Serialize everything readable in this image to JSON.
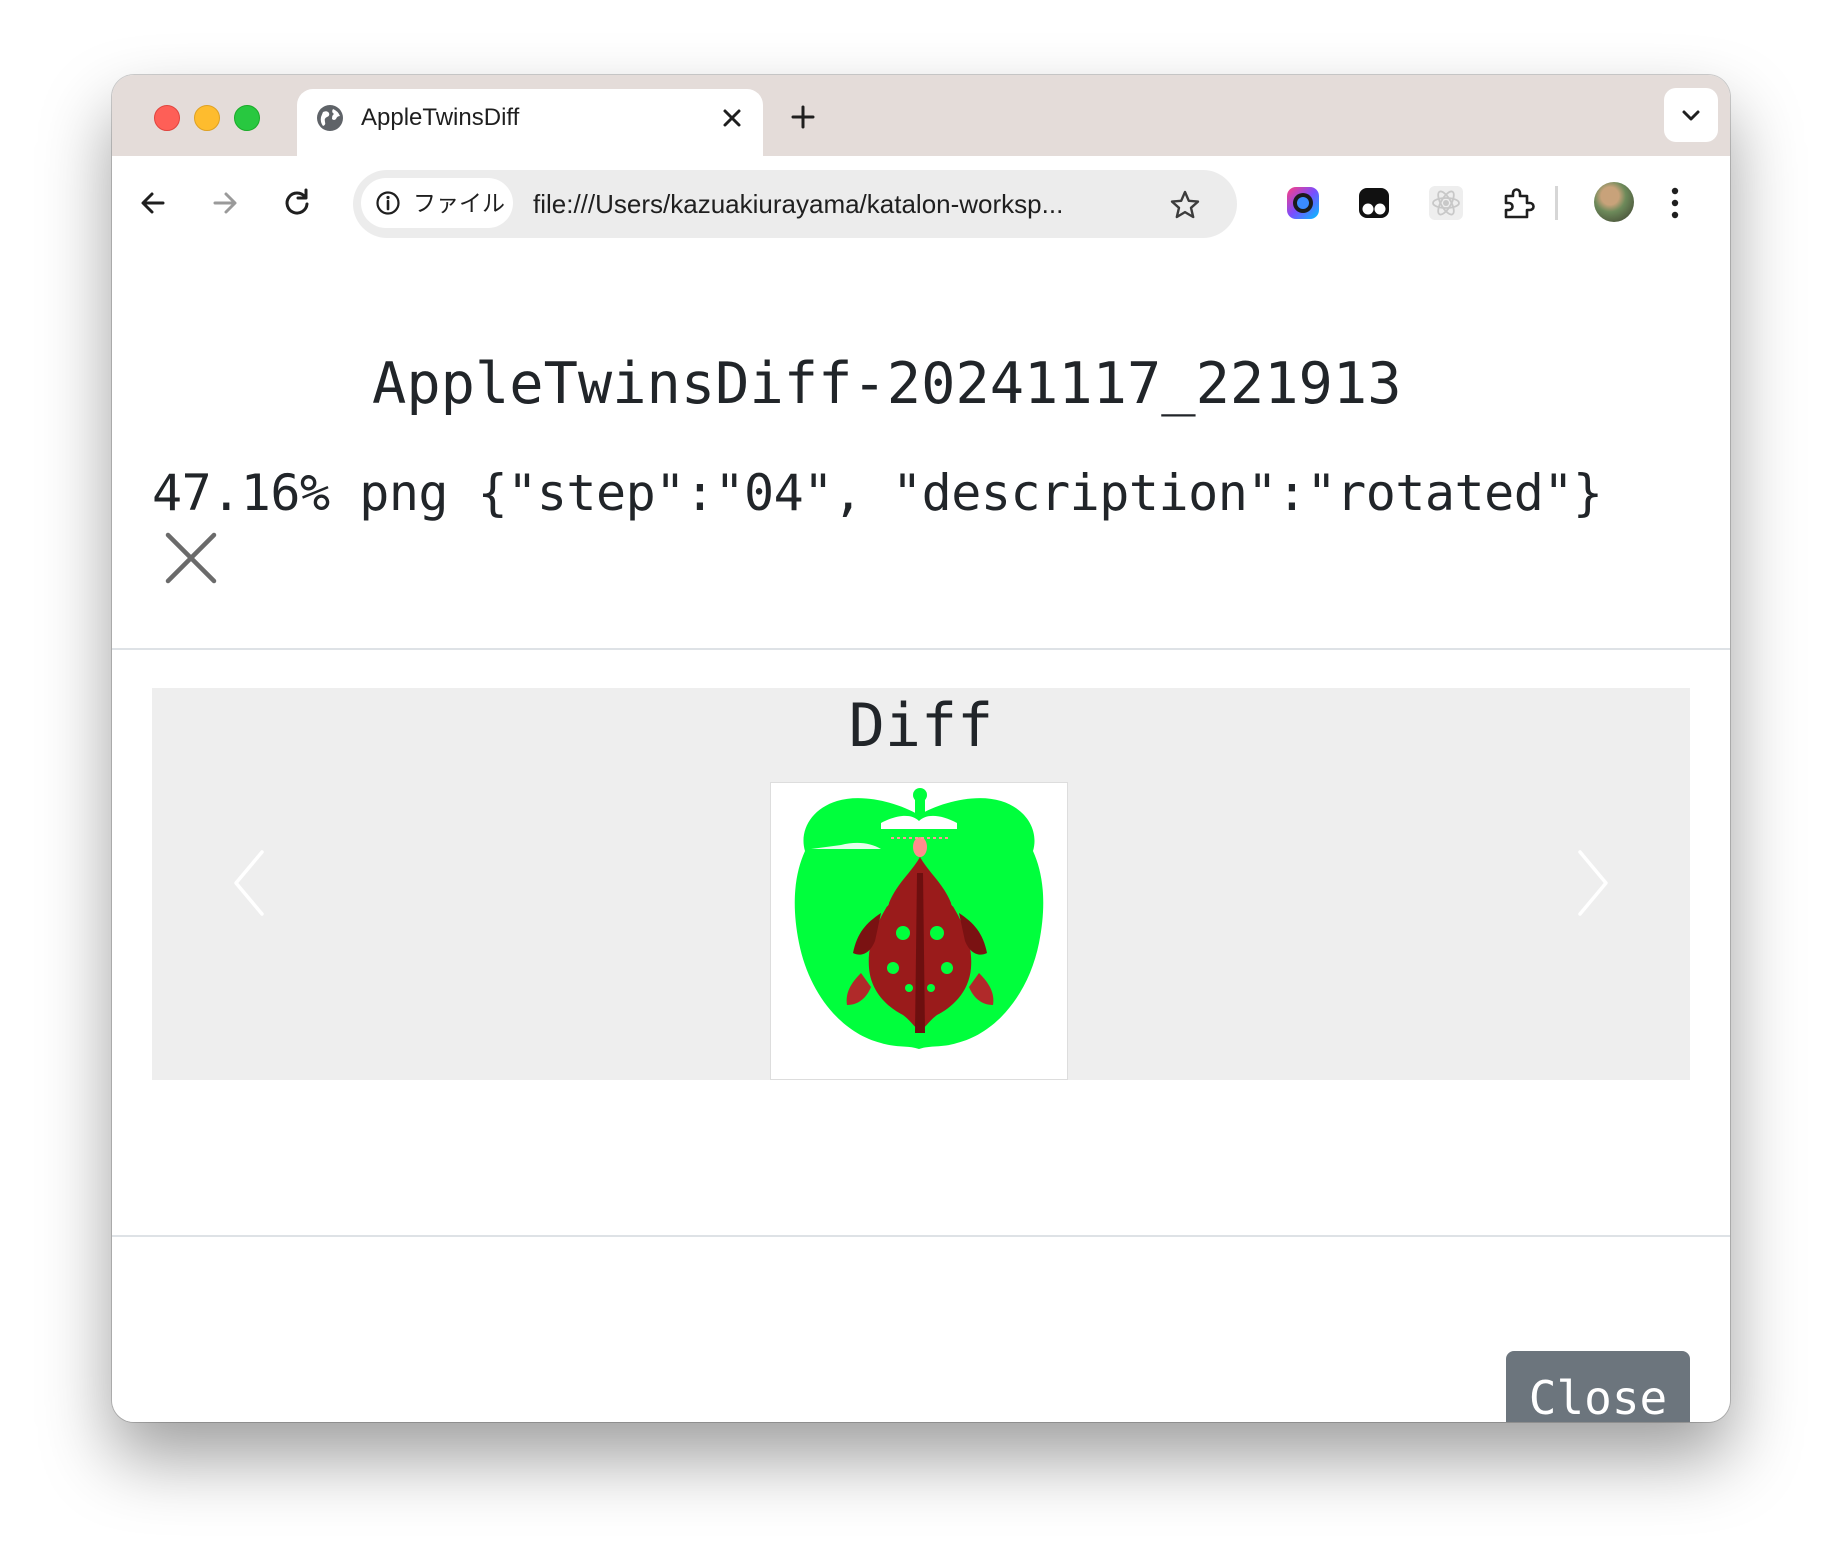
{
  "browser": {
    "tab_title": "AppleTwinsDiff",
    "omnibox_chip": "ファイル",
    "url": "file:///Users/kazuakiurayama/katalon-worksp..."
  },
  "modal": {
    "title": "AppleTwinsDiff-20241117_221913",
    "meta": "47.16% png {\"step\":\"04\", \"description\":\"rotated\"}",
    "carousel": {
      "caption": "Diff",
      "image_icon": "apple-diff-image"
    },
    "close_label": "Close"
  },
  "colors": {
    "close_button": "#6c757d",
    "diff_green": "#00ff3c",
    "diff_red": "#a01818",
    "carousel_bg": "#eeeeee",
    "tabstrip_bg": "#e4dcd9"
  }
}
